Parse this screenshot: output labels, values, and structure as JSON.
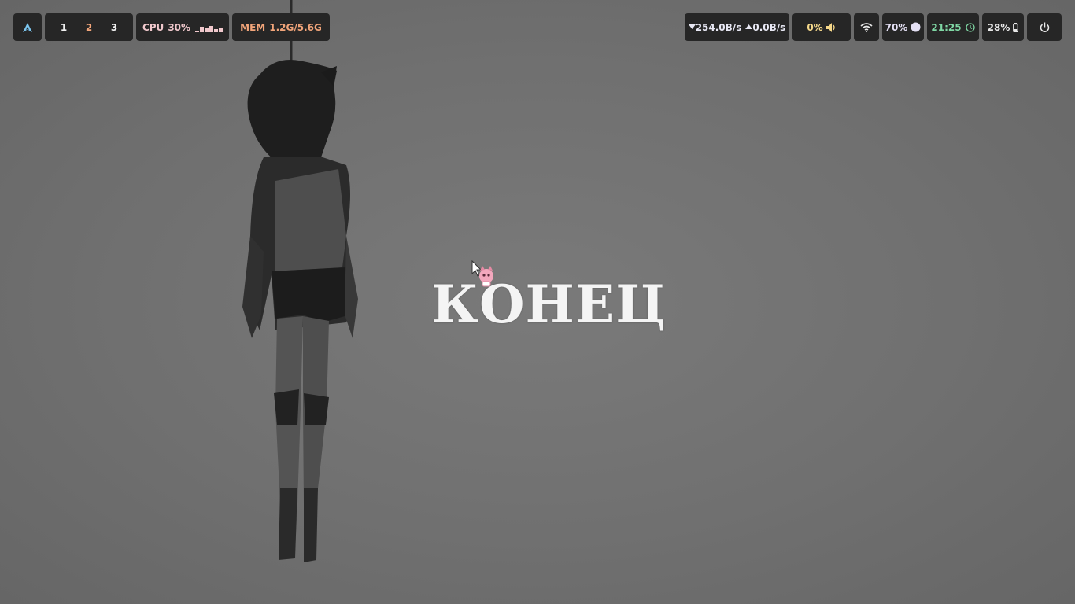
{
  "wallpaper": {
    "text": "КОНЕЦ"
  },
  "bar": {
    "launcher": {
      "icon": "arch-logo-icon"
    },
    "workspaces": [
      {
        "label": "1",
        "color": "#f0f0f0"
      },
      {
        "label": "2",
        "color": "#f2a57a"
      },
      {
        "label": "3",
        "color": "#f0f0f0"
      }
    ],
    "cpu": {
      "label": "CPU",
      "value": "30%",
      "history": [
        0.2,
        0.6,
        0.4,
        0.7,
        0.3,
        0.5
      ]
    },
    "mem": {
      "label": "MEM",
      "value": "1.2G/5.6G"
    },
    "network": {
      "down": "254.0B/s",
      "up": "0.0B/s"
    },
    "volume": {
      "value": "0%",
      "icon": "speaker-icon"
    },
    "wifi": {
      "icon": "wifi-icon"
    },
    "brightness": {
      "value": "70%",
      "icon": "brightness-icon"
    },
    "clock": {
      "time": "21:25",
      "icon": "clock-icon"
    },
    "battery": {
      "value": "28%",
      "icon": "battery-icon"
    },
    "power": {
      "icon": "power-icon"
    }
  },
  "colors": {
    "bar_bg": "#262626",
    "desktop_bg": "#707070",
    "accent_orange": "#f2a57a",
    "accent_green": "#7fd7a4",
    "accent_pink": "#f0c8cc"
  }
}
